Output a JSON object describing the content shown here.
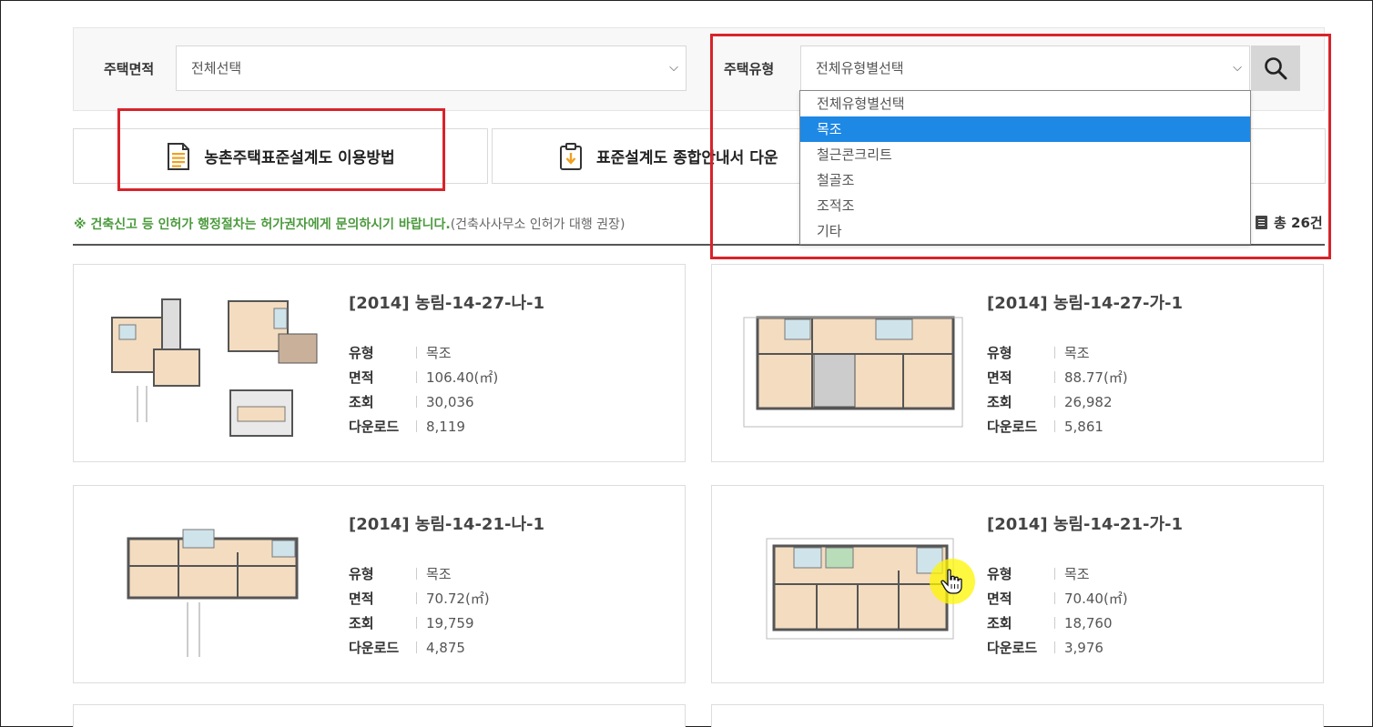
{
  "filters": {
    "area_label": "주택면적",
    "area_value": "전체선택",
    "type_label": "주택유형",
    "type_value": "전체유형별선택",
    "type_options": [
      "전체유형별선택",
      "목조",
      "철근콘크리트",
      "철골조",
      "조적조",
      "기타"
    ],
    "selected_option_index": 1
  },
  "guides": {
    "usage_label": "농촌주택표준설계도 이용방법",
    "overview_label": "표준설계도 종합안내서 다운"
  },
  "notice": {
    "main": "※ 건축신고 등 인허가 행정절차는 허가권자에게 문의하시기 바랍니다.",
    "sub": "(건축사사무소 인허가 대행 권장)"
  },
  "total": {
    "label": "총 26건"
  },
  "spec_labels": {
    "type": "유형",
    "area": "면적",
    "views": "조회",
    "downloads": "다운로드"
  },
  "designs": [
    {
      "title": "[2014] 농림-14-27-나-1",
      "type": "목조",
      "area": "106.40(㎡)",
      "views": "30,036",
      "downloads": "8,119"
    },
    {
      "title": "[2014] 농림-14-27-가-1",
      "type": "목조",
      "area": "88.77(㎡)",
      "views": "26,982",
      "downloads": "5,861"
    },
    {
      "title": "[2014] 농림-14-21-나-1",
      "type": "목조",
      "area": "70.72(㎡)",
      "views": "19,759",
      "downloads": "4,875"
    },
    {
      "title": "[2014] 농림-14-21-가-1",
      "type": "목조",
      "area": "70.40(㎡)",
      "views": "18,760",
      "downloads": "3,976"
    }
  ],
  "colors": {
    "highlight": "#d8232a",
    "selected_option": "#1e88e5",
    "notice_green": "#4b9a3d"
  },
  "icons": {
    "search": "search-icon",
    "document": "document-icon",
    "clipboard": "clipboard-download-icon",
    "chevron": "chevron-down-icon"
  }
}
